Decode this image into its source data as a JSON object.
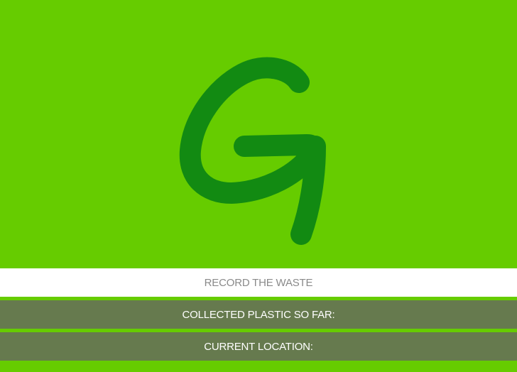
{
  "colors": {
    "background": "#66cc00",
    "logo": "#128a12",
    "record_bar": "#ffffff",
    "record_text": "#8a8a8a",
    "info_bar": "#667a4e",
    "info_text": "#ffffff"
  },
  "logo": {
    "icon": "brush-letter-g-logo",
    "letter": "G"
  },
  "record_button": {
    "label": "RECORD THE WASTE"
  },
  "plastic_info": {
    "label": "COLLECTED PLASTIC SO FAR:"
  },
  "location_info": {
    "label": "CURRENT LOCATION:"
  }
}
